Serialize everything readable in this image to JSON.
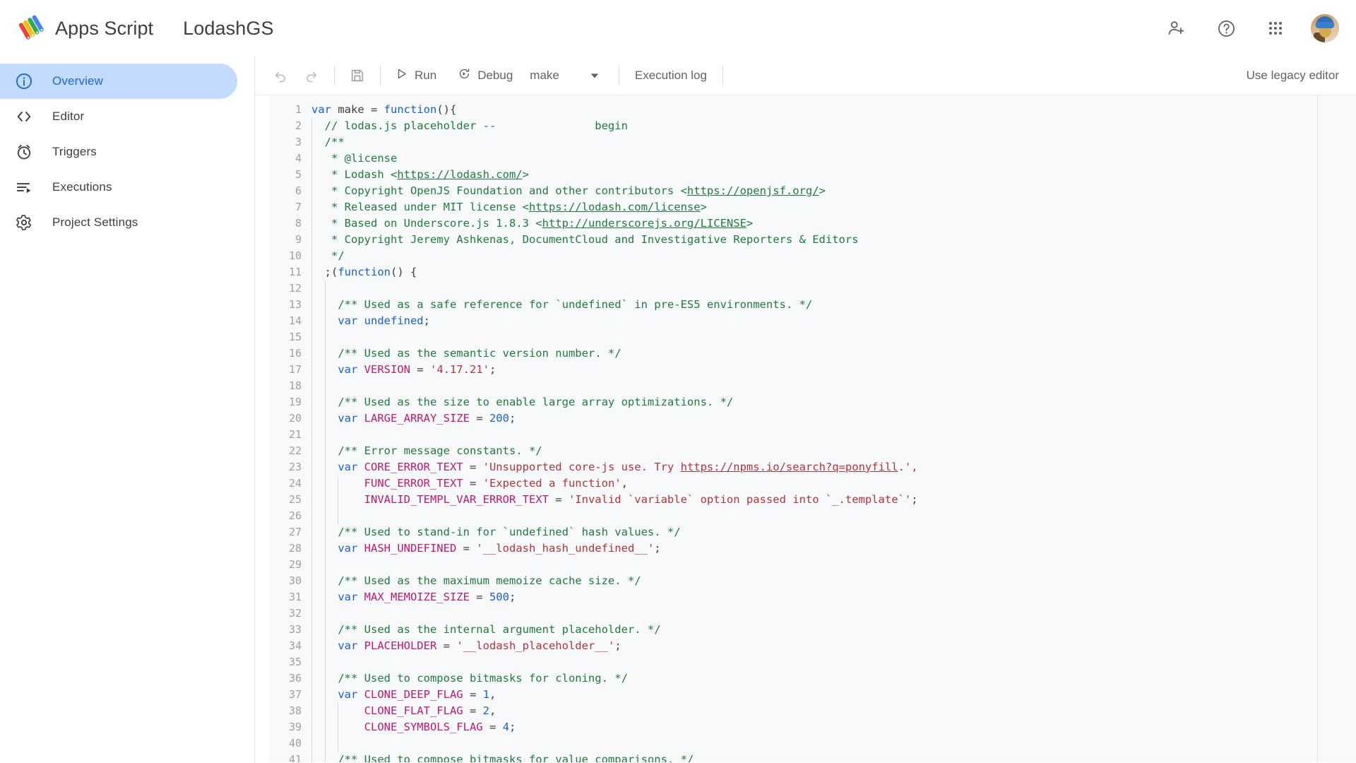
{
  "header": {
    "logo_icon": "apps-script-logo",
    "app_name": "Apps Script",
    "project_name": "LodashGS",
    "actions": [
      {
        "icon": "person-add-icon",
        "name": "add-collaborator-button"
      },
      {
        "icon": "help-circle-icon",
        "name": "help-button"
      },
      {
        "icon": "apps-grid-icon",
        "name": "google-apps-button"
      },
      {
        "icon": "avatar-icon",
        "name": "account-avatar"
      }
    ]
  },
  "sidebar": {
    "items": [
      {
        "label": "Overview",
        "icon": "info-circle-icon",
        "active": true
      },
      {
        "label": "Editor",
        "icon": "code-brackets-icon",
        "active": false
      },
      {
        "label": "Triggers",
        "icon": "alarm-clock-icon",
        "active": false
      },
      {
        "label": "Executions",
        "icon": "execution-list-icon",
        "active": false
      },
      {
        "label": "Project Settings",
        "icon": "gear-icon",
        "active": false
      }
    ]
  },
  "toolbar": {
    "undo_label": "undo-icon",
    "redo_label": "redo-icon",
    "save_label": "save-icon",
    "run_label": "Run",
    "debug_label": "Debug",
    "function_name": "make",
    "function_caret": "chevron-down-icon",
    "execution_log_label": "Execution log",
    "legacy_editor_label": "Use legacy editor"
  },
  "colors": {
    "accent_blue": "#1967d2",
    "active_bg": "#c2dbff",
    "keyword": "#1a5fd0",
    "comment": "#217a3c",
    "string": "#b5333b",
    "constant": "#c2186f",
    "text": "#3c4043",
    "gutter": "#9aa0a6",
    "code_bg": "#f8f9fb"
  },
  "editor": {
    "language": "javascript",
    "first_line": 1,
    "lines": [
      {
        "n": 1,
        "indent": 0,
        "tokens": [
          {
            "t": "var ",
            "c": "kw"
          },
          {
            "t": "make ",
            "c": "plain"
          },
          {
            "t": "= ",
            "c": "plain"
          },
          {
            "t": "function",
            "c": "kw"
          },
          {
            "t": "(){",
            "c": "plain"
          }
        ]
      },
      {
        "n": 2,
        "indent": 1,
        "tokens": [
          {
            "t": "  // lodas.js placeholder --               begin",
            "c": "cmt"
          }
        ]
      },
      {
        "n": 3,
        "indent": 1,
        "tokens": [
          {
            "t": "  /**",
            "c": "cmt"
          }
        ]
      },
      {
        "n": 4,
        "indent": 1,
        "tokens": [
          {
            "t": "   * @license",
            "c": "cmt"
          }
        ]
      },
      {
        "n": 5,
        "indent": 1,
        "tokens": [
          {
            "t": "   * Lodash <",
            "c": "cmt"
          },
          {
            "t": "https://lodash.com/",
            "c": "link"
          },
          {
            "t": ">",
            "c": "cmt"
          }
        ]
      },
      {
        "n": 6,
        "indent": 1,
        "tokens": [
          {
            "t": "   * Copyright OpenJS Foundation and other contributors <",
            "c": "cmt"
          },
          {
            "t": "https://openjsf.org/",
            "c": "link"
          },
          {
            "t": ">",
            "c": "cmt"
          }
        ]
      },
      {
        "n": 7,
        "indent": 1,
        "tokens": [
          {
            "t": "   * Released under MIT license <",
            "c": "cmt"
          },
          {
            "t": "https://lodash.com/license",
            "c": "link"
          },
          {
            "t": ">",
            "c": "cmt"
          }
        ]
      },
      {
        "n": 8,
        "indent": 1,
        "tokens": [
          {
            "t": "   * Based on Underscore.js 1.8.3 <",
            "c": "cmt"
          },
          {
            "t": "http://underscorejs.org/LICENSE",
            "c": "link"
          },
          {
            "t": ">",
            "c": "cmt"
          }
        ]
      },
      {
        "n": 9,
        "indent": 1,
        "tokens": [
          {
            "t": "   * Copyright Jeremy Ashkenas, DocumentCloud and Investigative Reporters & Editors",
            "c": "cmt"
          }
        ]
      },
      {
        "n": 10,
        "indent": 1,
        "tokens": [
          {
            "t": "   */",
            "c": "cmt"
          }
        ]
      },
      {
        "n": 11,
        "indent": 1,
        "tokens": [
          {
            "t": "  ;(",
            "c": "plain"
          },
          {
            "t": "function",
            "c": "kw"
          },
          {
            "t": "() {",
            "c": "plain"
          }
        ]
      },
      {
        "n": 12,
        "indent": 2,
        "tokens": []
      },
      {
        "n": 13,
        "indent": 2,
        "tokens": [
          {
            "t": "    /** Used as a safe reference for `undefined` in pre-ES5 environments. */",
            "c": "cmt"
          }
        ]
      },
      {
        "n": 14,
        "indent": 2,
        "tokens": [
          {
            "t": "    ",
            "c": "plain"
          },
          {
            "t": "var ",
            "c": "kw"
          },
          {
            "t": "undefined",
            "c": "kw"
          },
          {
            "t": ";",
            "c": "plain"
          }
        ]
      },
      {
        "n": 15,
        "indent": 2,
        "tokens": []
      },
      {
        "n": 16,
        "indent": 2,
        "tokens": [
          {
            "t": "    /** Used as the semantic version number. */",
            "c": "cmt"
          }
        ]
      },
      {
        "n": 17,
        "indent": 2,
        "tokens": [
          {
            "t": "    ",
            "c": "plain"
          },
          {
            "t": "var ",
            "c": "kw"
          },
          {
            "t": "VERSION",
            "c": "const"
          },
          {
            "t": " = ",
            "c": "plain"
          },
          {
            "t": "'4.17.21'",
            "c": "str"
          },
          {
            "t": ";",
            "c": "plain"
          }
        ]
      },
      {
        "n": 18,
        "indent": 2,
        "tokens": []
      },
      {
        "n": 19,
        "indent": 2,
        "tokens": [
          {
            "t": "    /** Used as the size to enable large array optimizations. */",
            "c": "cmt"
          }
        ]
      },
      {
        "n": 20,
        "indent": 2,
        "tokens": [
          {
            "t": "    ",
            "c": "plain"
          },
          {
            "t": "var ",
            "c": "kw"
          },
          {
            "t": "LARGE_ARRAY_SIZE",
            "c": "const"
          },
          {
            "t": " = ",
            "c": "plain"
          },
          {
            "t": "200",
            "c": "num"
          },
          {
            "t": ";",
            "c": "plain"
          }
        ]
      },
      {
        "n": 21,
        "indent": 2,
        "tokens": []
      },
      {
        "n": 22,
        "indent": 2,
        "tokens": [
          {
            "t": "    /** Error message constants. */",
            "c": "cmt"
          }
        ]
      },
      {
        "n": 23,
        "indent": 2,
        "tokens": [
          {
            "t": "    ",
            "c": "plain"
          },
          {
            "t": "var ",
            "c": "kw"
          },
          {
            "t": "CORE_ERROR_TEXT",
            "c": "const"
          },
          {
            "t": " = ",
            "c": "plain"
          },
          {
            "t": "'Unsupported core-js use. Try ",
            "c": "str"
          },
          {
            "t": "https://npms.io/search?q=ponyfill",
            "c": "linkred"
          },
          {
            "t": ".',",
            "c": "str"
          }
        ]
      },
      {
        "n": 24,
        "indent": 3,
        "tokens": [
          {
            "t": "        ",
            "c": "plain"
          },
          {
            "t": "FUNC_ERROR_TEXT",
            "c": "const"
          },
          {
            "t": " = ",
            "c": "plain"
          },
          {
            "t": "'Expected a function'",
            "c": "str"
          },
          {
            "t": ",",
            "c": "plain"
          }
        ]
      },
      {
        "n": 25,
        "indent": 3,
        "tokens": [
          {
            "t": "        ",
            "c": "plain"
          },
          {
            "t": "INVALID_TEMPL_VAR_ERROR_TEXT",
            "c": "const"
          },
          {
            "t": " = ",
            "c": "plain"
          },
          {
            "t": "'Invalid `variable` option passed into `_.template`'",
            "c": "str"
          },
          {
            "t": ";",
            "c": "plain"
          }
        ]
      },
      {
        "n": 26,
        "indent": 3,
        "tokens": []
      },
      {
        "n": 27,
        "indent": 2,
        "tokens": [
          {
            "t": "    /** Used to stand-in for `undefined` hash values. */",
            "c": "cmt"
          }
        ]
      },
      {
        "n": 28,
        "indent": 2,
        "tokens": [
          {
            "t": "    ",
            "c": "plain"
          },
          {
            "t": "var ",
            "c": "kw"
          },
          {
            "t": "HASH_UNDEFINED",
            "c": "const"
          },
          {
            "t": " = ",
            "c": "plain"
          },
          {
            "t": "'__lodash_hash_undefined__'",
            "c": "str"
          },
          {
            "t": ";",
            "c": "plain"
          }
        ]
      },
      {
        "n": 29,
        "indent": 2,
        "tokens": []
      },
      {
        "n": 30,
        "indent": 2,
        "tokens": [
          {
            "t": "    /** Used as the maximum memoize cache size. */",
            "c": "cmt"
          }
        ]
      },
      {
        "n": 31,
        "indent": 2,
        "tokens": [
          {
            "t": "    ",
            "c": "plain"
          },
          {
            "t": "var ",
            "c": "kw"
          },
          {
            "t": "MAX_MEMOIZE_SIZE",
            "c": "const"
          },
          {
            "t": " = ",
            "c": "plain"
          },
          {
            "t": "500",
            "c": "num"
          },
          {
            "t": ";",
            "c": "plain"
          }
        ]
      },
      {
        "n": 32,
        "indent": 2,
        "tokens": []
      },
      {
        "n": 33,
        "indent": 2,
        "tokens": [
          {
            "t": "    /** Used as the internal argument placeholder. */",
            "c": "cmt"
          }
        ]
      },
      {
        "n": 34,
        "indent": 2,
        "tokens": [
          {
            "t": "    ",
            "c": "plain"
          },
          {
            "t": "var ",
            "c": "kw"
          },
          {
            "t": "PLACEHOLDER",
            "c": "const"
          },
          {
            "t": " = ",
            "c": "plain"
          },
          {
            "t": "'__lodash_placeholder__'",
            "c": "str"
          },
          {
            "t": ";",
            "c": "plain"
          }
        ]
      },
      {
        "n": 35,
        "indent": 2,
        "tokens": []
      },
      {
        "n": 36,
        "indent": 2,
        "tokens": [
          {
            "t": "    /** Used to compose bitmasks for cloning. */",
            "c": "cmt"
          }
        ]
      },
      {
        "n": 37,
        "indent": 2,
        "tokens": [
          {
            "t": "    ",
            "c": "plain"
          },
          {
            "t": "var ",
            "c": "kw"
          },
          {
            "t": "CLONE_DEEP_FLAG",
            "c": "const"
          },
          {
            "t": " = ",
            "c": "plain"
          },
          {
            "t": "1",
            "c": "num"
          },
          {
            "t": ",",
            "c": "plain"
          }
        ]
      },
      {
        "n": 38,
        "indent": 3,
        "tokens": [
          {
            "t": "        ",
            "c": "plain"
          },
          {
            "t": "CLONE_FLAT_FLAG",
            "c": "const"
          },
          {
            "t": " = ",
            "c": "plain"
          },
          {
            "t": "2",
            "c": "num"
          },
          {
            "t": ",",
            "c": "plain"
          }
        ]
      },
      {
        "n": 39,
        "indent": 3,
        "tokens": [
          {
            "t": "        ",
            "c": "plain"
          },
          {
            "t": "CLONE_SYMBOLS_FLAG",
            "c": "const"
          },
          {
            "t": " = ",
            "c": "plain"
          },
          {
            "t": "4",
            "c": "num"
          },
          {
            "t": ";",
            "c": "plain"
          }
        ]
      },
      {
        "n": 40,
        "indent": 3,
        "tokens": []
      },
      {
        "n": 41,
        "indent": 2,
        "tokens": [
          {
            "t": "    /** Used to compose bitmasks for value comparisons. */",
            "c": "cmt"
          }
        ]
      }
    ]
  }
}
